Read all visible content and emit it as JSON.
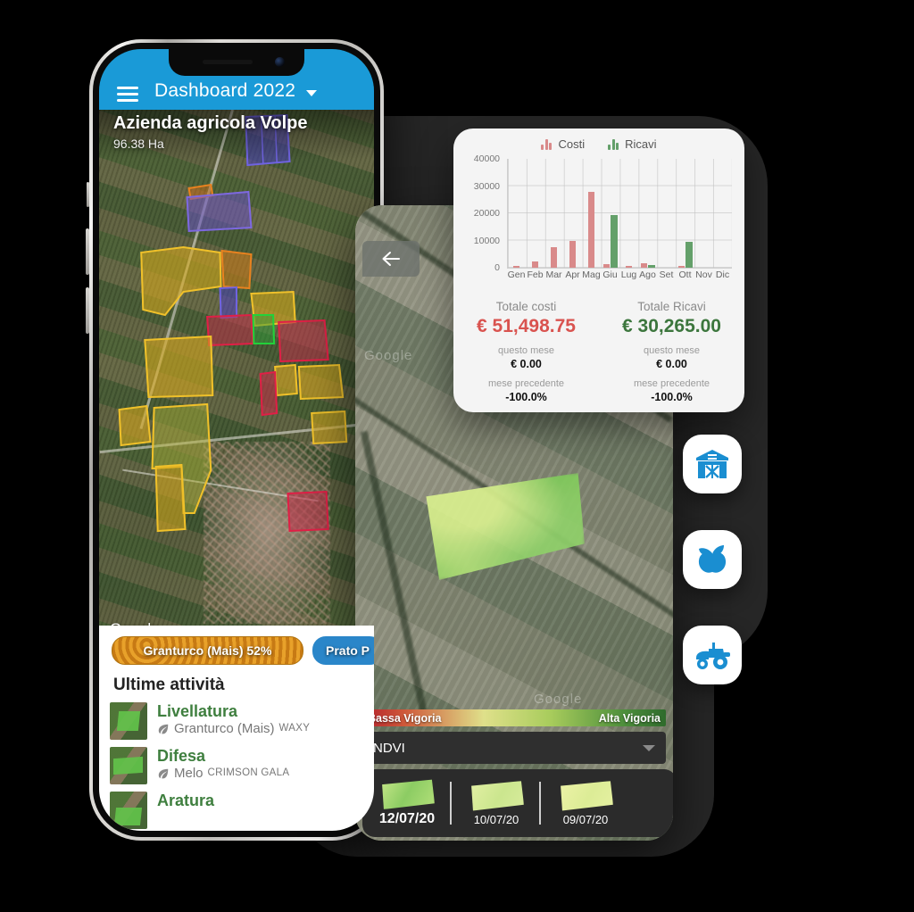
{
  "phone1": {
    "appbar": {
      "title": "Dashboard 2022",
      "menu_icon": "hamburger-menu-icon",
      "dropdown_icon": "caret-down-icon"
    },
    "map": {
      "farm_name": "Azienda agricola Volpe",
      "area": "96.38 Ha",
      "attribution": "Google"
    },
    "chips": [
      {
        "label": "Granturco (Mais) 52%",
        "style": "corn"
      },
      {
        "label": "Prato P",
        "style": "blue"
      }
    ],
    "section_title": "Ultime attività",
    "activities": [
      {
        "name": "Livellatura",
        "crop": "Granturco (Mais)",
        "variety": "WAXY"
      },
      {
        "name": "Difesa",
        "crop": "Melo",
        "variety": "CRIMSON GALA"
      },
      {
        "name": "Aratura",
        "crop": "",
        "variety": ""
      }
    ]
  },
  "phone2": {
    "back_icon": "arrow-left-icon",
    "attribution": "Google",
    "vigor": {
      "low": "Bassa Vigoria",
      "high": "Alta Vigoria"
    },
    "index_select": {
      "value": "NDVI",
      "caret_icon": "caret-down-icon"
    },
    "thumbnails": [
      {
        "date": "12/07/20",
        "active": true
      },
      {
        "date": "10/07/20",
        "active": false
      },
      {
        "date": "09/07/20",
        "active": false
      }
    ]
  },
  "chart_card": {
    "totals": [
      {
        "caption": "Totale costi",
        "value": "€ 51,498.75",
        "color": "#d9534f",
        "sub_caption": "questo mese",
        "sub_value": "€ 0.00",
        "prev_caption": "mese precedente",
        "prev_value": "-100.0%"
      },
      {
        "caption": "Totale Ricavi",
        "value": "€ 30,265.00",
        "color": "#3c763d",
        "sub_caption": "questo mese",
        "sub_value": "€ 0.00",
        "prev_caption": "mese precedente",
        "prev_value": "-100.0%"
      }
    ]
  },
  "chart_data": {
    "type": "bar",
    "title": "",
    "xlabel": "",
    "ylabel": "",
    "ylim": [
      0,
      40000
    ],
    "yticks": [
      0,
      10000,
      20000,
      30000,
      40000
    ],
    "ytick_labels": [
      "0",
      "10000",
      "20000",
      "30000",
      "40000"
    ],
    "grid": true,
    "legend_position": "top-center",
    "categories": [
      "Gen",
      "Feb",
      "Mar",
      "Apr",
      "Mag",
      "Giu",
      "Lug",
      "Ago",
      "Set",
      "Ott",
      "Nov",
      "Dic"
    ],
    "series": [
      {
        "name": "Costi",
        "color": "#d98a8a",
        "values": [
          350,
          2300,
          7500,
          9900,
          27900,
          1200,
          350,
          1750,
          0,
          250,
          0,
          0
        ]
      },
      {
        "name": "Ricavi",
        "color": "#64a06a",
        "values": [
          0,
          0,
          0,
          0,
          0,
          19400,
          0,
          1150,
          0,
          9500,
          0,
          0
        ]
      }
    ]
  },
  "fabs": [
    {
      "icon": "barn-icon",
      "name": "farm"
    },
    {
      "icon": "apple-icon",
      "name": "crops"
    },
    {
      "icon": "tractor-icon",
      "name": "machinery"
    }
  ],
  "colors": {
    "accent": "#1a9ad7",
    "costs": "#d9534f",
    "revenue": "#3c763d",
    "backdrop": "#262626"
  }
}
